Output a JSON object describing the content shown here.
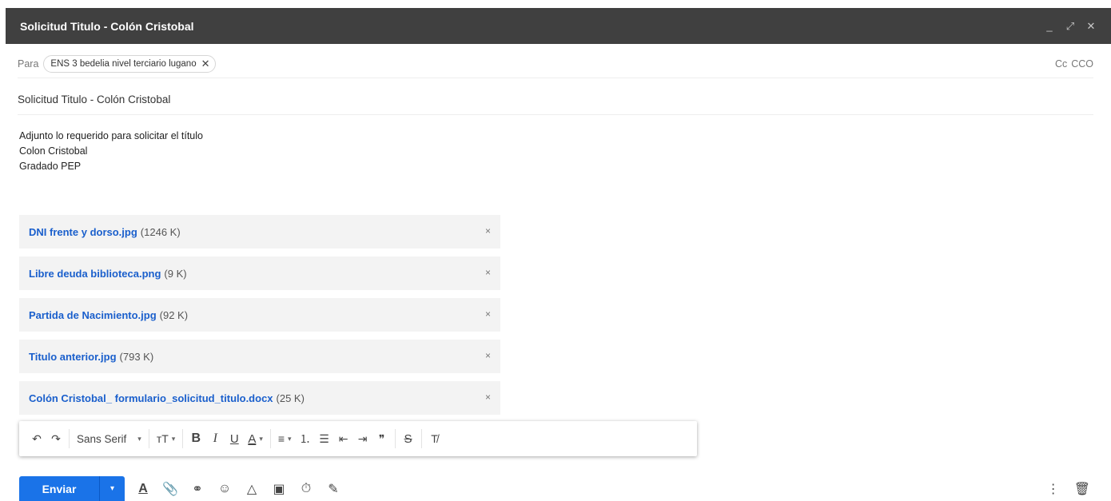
{
  "window": {
    "title": "Solicitud Titulo - Colón Cristobal",
    "controls": {
      "minimize": "_",
      "expand": "⤢",
      "close": "✕"
    }
  },
  "to_row": {
    "label": "Para",
    "recipient": "ENS 3 bedelia nivel terciario lugano",
    "remove": "✕",
    "cc": "Cc",
    "bcc": "CCO"
  },
  "subject": "Solicitud Titulo - Colón Cristobal",
  "body_lines": [
    "Adjunto lo requerido para solicitar el título",
    "Colon Cristobal",
    "Gradado PEP"
  ],
  "attachments": [
    {
      "name": "DNI frente y dorso.jpg",
      "size": "(1246 K)"
    },
    {
      "name": "Libre deuda biblioteca.png",
      "size": "(9 K)"
    },
    {
      "name": "Partida de Nacimiento.jpg",
      "size": "(92 K)"
    },
    {
      "name": "Titulo anterior.jpg",
      "size": "(793 K)"
    },
    {
      "name": "Colón Cristobal_ formulario_solicitud_titulo.docx",
      "size": "(25 K)"
    }
  ],
  "attachment_remove": "×",
  "format_toolbar": {
    "undo": "↶",
    "redo": "↷",
    "font": "Sans Serif",
    "caret": "▾",
    "size": "тT",
    "bold": "B",
    "italic": "I",
    "underline": "U",
    "text_color": "A",
    "align": "≡",
    "numbered_list": "⒈",
    "bulleted_list": "☰",
    "indent_less": "⇤",
    "indent_more": "⇥",
    "quote": "❞",
    "strikethrough": "S",
    "remove_format": "T̸"
  },
  "bottom": {
    "send": "Enviar",
    "send_options": "▾",
    "icons": {
      "formatting": "A",
      "attach": "📎",
      "link": "⚭",
      "emoji": "☺",
      "drive": "△",
      "photo": "▣",
      "lock": "⏱",
      "signature": "✎"
    },
    "more": "⋮",
    "discard": "🗑"
  },
  "colors": {
    "titlebar": "#404040",
    "accent": "#1a73e8",
    "link": "#1a5fcc",
    "attachment_bg": "#f3f3f3"
  }
}
